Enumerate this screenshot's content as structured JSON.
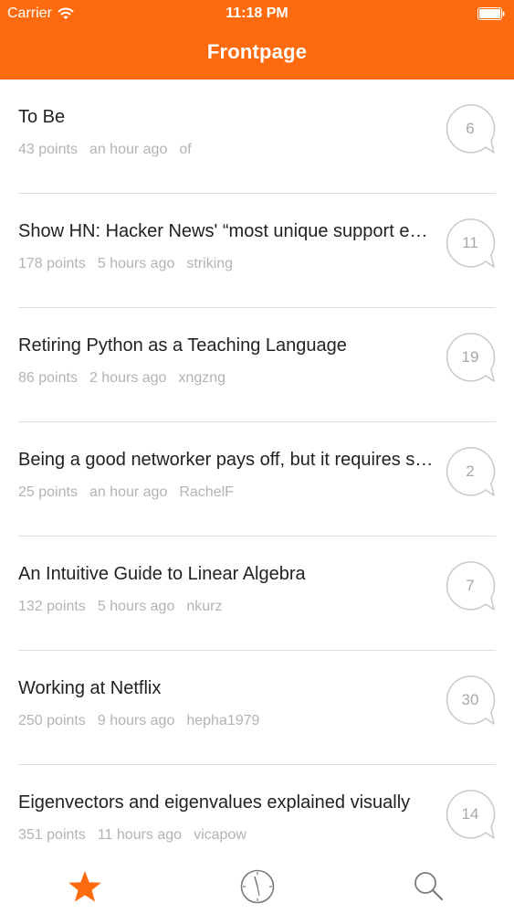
{
  "status_bar": {
    "carrier": "Carrier",
    "time": "11:18 PM"
  },
  "nav": {
    "title": "Frontpage"
  },
  "stories": [
    {
      "title": "To Be",
      "points": "43 points",
      "time": "an hour ago",
      "author": "of",
      "comments": "6"
    },
    {
      "title": "Show HN: Hacker News' “most unique support e…",
      "points": "178 points",
      "time": "5 hours ago",
      "author": "striking",
      "comments": "11"
    },
    {
      "title": "Retiring Python as a Teaching Language",
      "points": "86 points",
      "time": "2 hours ago",
      "author": "xngzng",
      "comments": "19"
    },
    {
      "title": "Being a good networker pays off, but it requires s…",
      "points": "25 points",
      "time": "an hour ago",
      "author": "RachelF",
      "comments": "2"
    },
    {
      "title": "An Intuitive Guide to Linear Algebra",
      "points": "132 points",
      "time": "5 hours ago",
      "author": "nkurz",
      "comments": "7"
    },
    {
      "title": "Working at Netflix",
      "points": "250 points",
      "time": "9 hours ago",
      "author": "hepha1979",
      "comments": "30"
    },
    {
      "title": "Eigenvectors and eigenvalues explained visually",
      "points": "351 points",
      "time": "11 hours ago",
      "author": "vicapow",
      "comments": "14"
    }
  ],
  "tab_bar": {
    "tabs": [
      {
        "icon": "star-icon",
        "selected": true
      },
      {
        "icon": "clock-icon",
        "selected": false
      },
      {
        "icon": "search-icon",
        "selected": false
      }
    ]
  },
  "colors": {
    "accent": "#fe6b0f",
    "meta_text": "#b3b3b3",
    "title_text": "#222222",
    "divider": "#dcdcdc"
  }
}
